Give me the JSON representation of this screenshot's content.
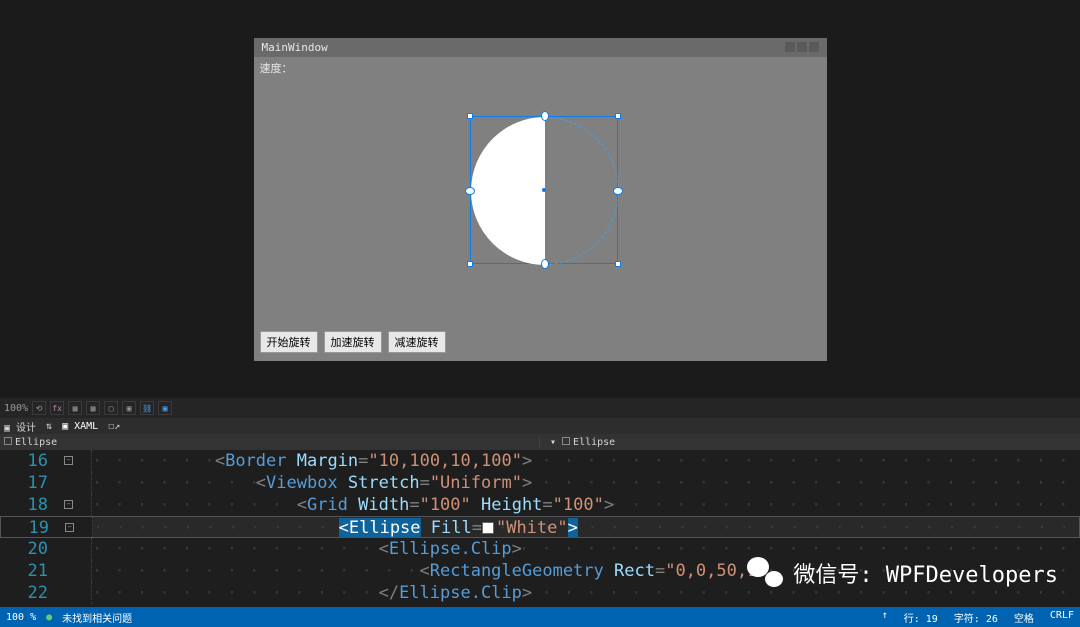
{
  "designer": {
    "window_title": "MainWindow",
    "speed_label": "速度：",
    "buttons": [
      "开始旋转",
      "加速旋转",
      "减速旋转"
    ]
  },
  "toolbar": {
    "zoom": "100%",
    "design_tab": "设计",
    "xaml_tab": "XAML"
  },
  "breadcrumb": {
    "left": "Ellipse",
    "right": "Ellipse"
  },
  "code": {
    "lines": [
      {
        "n": "16",
        "indent": 3,
        "parts": [
          [
            "punct",
            "<"
          ],
          [
            "tag",
            "Border"
          ],
          [
            "",
            ""
          ],
          [
            "attr",
            " Margin"
          ],
          [
            "punct",
            "="
          ],
          [
            "str",
            "\"10,100,10,100\""
          ],
          [
            "punct",
            ">"
          ]
        ]
      },
      {
        "n": "17",
        "indent": 4,
        "parts": [
          [
            "punct",
            "<"
          ],
          [
            "tag",
            "Viewbox"
          ],
          [
            "attr",
            " Stretch"
          ],
          [
            "punct",
            "="
          ],
          [
            "str",
            "\"Uniform\""
          ],
          [
            "punct",
            ">"
          ]
        ]
      },
      {
        "n": "18",
        "indent": 5,
        "parts": [
          [
            "punct",
            "<"
          ],
          [
            "tag",
            "Grid"
          ],
          [
            "attr",
            " Width"
          ],
          [
            "punct",
            "="
          ],
          [
            "str",
            "\"100\""
          ],
          [
            "attr",
            " Height"
          ],
          [
            "punct",
            "="
          ],
          [
            "str",
            "\"100\""
          ],
          [
            "punct",
            ">"
          ]
        ]
      },
      {
        "n": "19",
        "indent": 6,
        "hl": true,
        "parts": [
          [
            "sel-bg",
            "<Ellipse"
          ],
          [
            "attr",
            " Fill"
          ],
          [
            "punct",
            "="
          ],
          [
            "colorsq",
            ""
          ],
          [
            "str",
            "\"White\""
          ],
          [
            "sel-bg",
            ">"
          ]
        ]
      },
      {
        "n": "20",
        "indent": 7,
        "parts": [
          [
            "punct",
            "<"
          ],
          [
            "tag",
            "Ellipse.Clip"
          ],
          [
            "punct",
            ">"
          ]
        ]
      },
      {
        "n": "21",
        "indent": 8,
        "parts": [
          [
            "punct",
            "<"
          ],
          [
            "tag",
            "RectangleGeometry"
          ],
          [
            "attr",
            " Rect"
          ],
          [
            "punct",
            "="
          ],
          [
            "str",
            "\"0,0,50,1"
          ]
        ]
      },
      {
        "n": "22",
        "indent": 7,
        "parts": [
          [
            "punct",
            "</"
          ],
          [
            "tag",
            "Ellipse.Clip"
          ],
          [
            "punct",
            ">"
          ]
        ]
      }
    ]
  },
  "status": {
    "pct": "100 %",
    "issues": "未找到相关问题",
    "line": "行: 19",
    "char": "字符: 26",
    "spaces": "空格",
    "crlf": "CRLF"
  },
  "overlay": {
    "text": "微信号: WPFDevelopers"
  }
}
